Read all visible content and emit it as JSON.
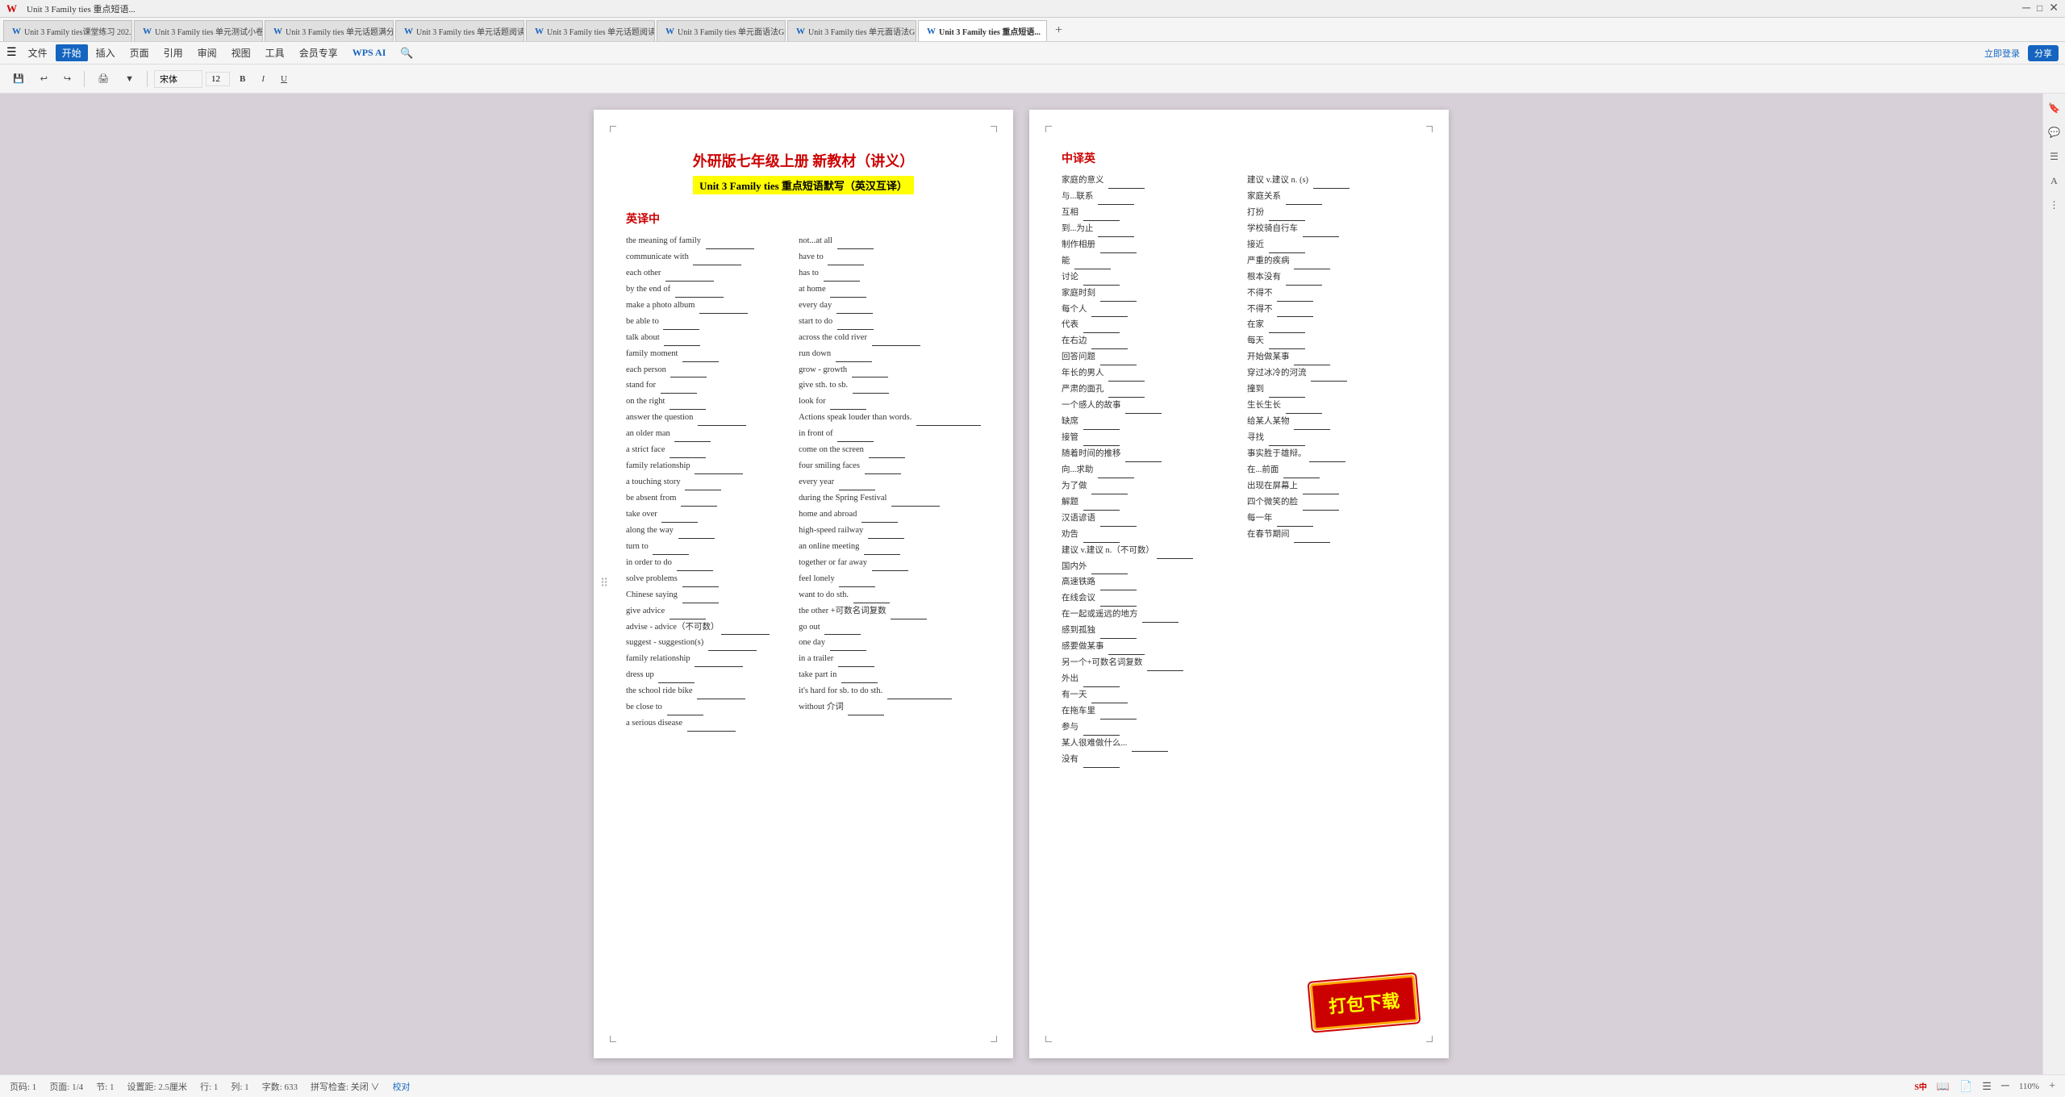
{
  "app": {
    "title": "WPS",
    "tabs": [
      {
        "label": "Unit 3 Family ties课堂练习 202...",
        "active": false
      },
      {
        "label": "Unit 3 Family ties 单元测试小卷 2...",
        "active": false
      },
      {
        "label": "Unit 3 Family ties 单元话题满分写...",
        "active": false
      },
      {
        "label": "Unit 3 Family ties 单元话题阅读...",
        "active": false
      },
      {
        "label": "Unit 3 Family ties 单元话题阅读...",
        "active": false
      },
      {
        "label": "Unit 3 Family ties 单元面语法Grammar...",
        "active": false
      },
      {
        "label": "Unit 3 Family ties 单元面语法Gramm...",
        "active": false
      },
      {
        "label": "Unit 3 Family ties 重点短语...",
        "active": true
      }
    ],
    "menu": [
      "文件",
      "插入",
      "页面",
      "引用",
      "审阅",
      "视图",
      "工具",
      "会员专享"
    ],
    "active_menu": "开始",
    "wps_ai": "WPS AI",
    "toolbar_items": [
      "开始"
    ]
  },
  "status_bar": {
    "page_info": "页码: 1  页面: 1/4  节: 1  设置距: 2.5厘米  行: 1  列: 1  字数: 633  拼写检查: 关闭 ~  校对",
    "zoom": "110%",
    "view_icons": [
      "阅读版式",
      "页面视图",
      "大纲视图"
    ]
  },
  "page1": {
    "title_main": "外研版七年级上册 新教材（讲义）",
    "title_sub": "Unit 3 Family ties  重点短语默写（英汉互译）",
    "section_en_cn": "英译中",
    "left_col": [
      "the meaning of family ______",
      "communicate with ______",
      "each other ______",
      "by the end of ______",
      "make a photo album ______",
      "be able to ______",
      "talk about ______",
      "family moment ______",
      "each person ______",
      "stand for ______",
      "on the right ______",
      "answer the question ______",
      "an older man ______",
      "a strict face ______",
      "family relationship ______",
      "a touching story ______",
      "be absent from ______",
      "take over ______",
      "along the way ______",
      "turn to ______",
      "in order to do ______",
      "solve problems ______",
      "Chinese saying ______",
      "give advice ______",
      "advise - advice（不可数）______",
      "suggest - suggestion(s) ______",
      "family relationship ______",
      "dress up ______",
      "the school ride bike ______",
      "be close to ______",
      "a serious disease ______"
    ],
    "right_col": [
      "not...at all ______",
      "have to ______",
      "has to ______",
      "at home ______",
      "every day ______",
      "start to do ______",
      "across the cold river ______",
      "run down ______",
      "grow - growth ______",
      "give sth. to sb. ______",
      "look for ______",
      "Actions speak louder than words. ______",
      "in front of ______",
      "come on the screen ______",
      "four smiling faces ______",
      "every year ______",
      "during the Spring Festival ______",
      "home and abroad ______",
      "high-speed railway ______",
      "an online meeting ______",
      "together or far away ______",
      "feel lonely ______",
      "want to do sth. ______",
      "the other +可数名词复数 ______",
      "go out ______",
      "one day ______",
      "in a trailer ______",
      "take part in ______",
      "it's hard for sb. to do sth. ______",
      "without 介词 ______"
    ]
  },
  "page2": {
    "section_cn_en": "中译英",
    "left_col": [
      "家庭的意义 ______",
      "与...联系 ______",
      "互相 ______",
      "到...为止 ______",
      "制作相册 ______",
      "能 ______",
      "讨论 ______",
      "家庭时刻 ______",
      "每个人 ______",
      "代表 ______",
      "在右边 ______",
      "回答问题 ______",
      "年长的男人 ______",
      "严肃的面孔 ______",
      "一个感人的故事 ______",
      "缺席 ______",
      "接管 ______",
      "随着时间的推移 ______",
      "向...求助 ______",
      "为了做 ______",
      "解题 ______",
      "汉语谚语 ______",
      "劝告 ______",
      "建议 v.建议 n.（不可数） ______",
      "国内外 ______",
      "高速铁路 ______",
      "在线会议 ______",
      "在一起或遥远的地方 ______",
      "感到孤独 ______",
      "感要做某事 ______",
      "另一个+可数名词复数 ______",
      "外出 ______",
      "有一天 ______",
      "在拖车里 ______",
      "参与 ______",
      "某人很难做什么... ______",
      "没有 ______"
    ],
    "right_col": [
      "建议 v.建议 n. (s) ______",
      "家庭关系 ______",
      "打扮 ______",
      "学校骑自行车 ______",
      "接近 ______",
      "严重的疾病 ______",
      "根本没有 ______",
      "不得不 ______",
      "不得不 ______",
      "在家 ______",
      "每天 ______",
      "开始做某事 ______",
      "穿过冰冷的河流 ______",
      "撞到 ______",
      "生长生长 ______",
      "给某人某物 ______",
      "寻找 ______",
      "事实胜于雄辩。______",
      "在...前面 ______",
      "出现在屏幕上 ______",
      "四个微笑的脸 ______",
      "每一年 ______",
      "在春节期间 ______"
    ]
  },
  "download_badge": {
    "text": "打包下载"
  }
}
